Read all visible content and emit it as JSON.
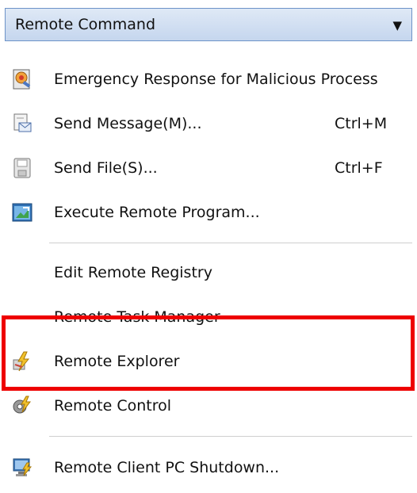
{
  "menu": {
    "title": "Remote Command",
    "dropdown_icon": "chevron-down-icon"
  },
  "items": [
    {
      "label": "Emergency Response for Malicious Process",
      "shortcut": "",
      "icon": "emergency-response-icon"
    },
    {
      "label": "Send Message(M)...",
      "shortcut": "Ctrl+M",
      "icon": "send-message-icon"
    },
    {
      "label": "Send File(S)...",
      "shortcut": "Ctrl+F",
      "icon": "send-file-icon"
    },
    {
      "label": "Execute Remote Program...",
      "shortcut": "",
      "icon": "execute-program-icon"
    },
    {
      "label": "Edit Remote Registry",
      "shortcut": "",
      "icon": ""
    },
    {
      "label": "Remote Task Manager",
      "shortcut": "",
      "icon": ""
    },
    {
      "label": "Remote Explorer",
      "shortcut": "",
      "icon": "remote-explorer-icon"
    },
    {
      "label": "Remote Control",
      "shortcut": "",
      "icon": "remote-control-icon"
    },
    {
      "label": "Remote Client PC Shutdown...",
      "shortcut": "",
      "icon": "shutdown-icon"
    }
  ],
  "highlight": {
    "target": "Remote Explorer",
    "color": "#ee0000"
  }
}
